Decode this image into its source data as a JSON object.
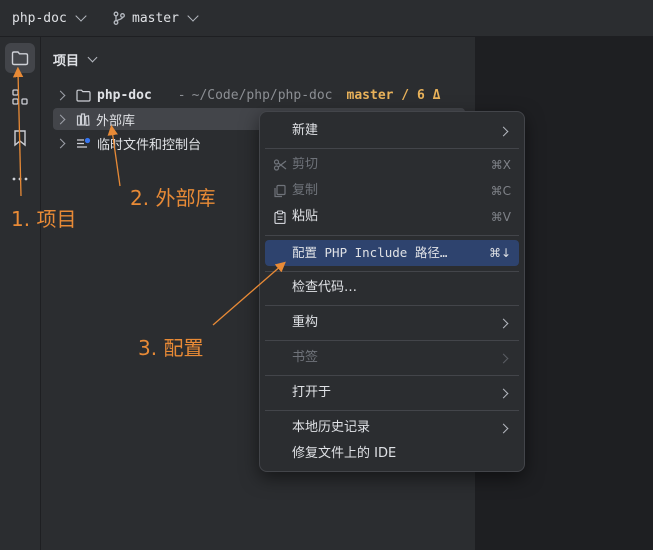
{
  "titlebar": {
    "project_name": "php-doc",
    "branch_name": "master"
  },
  "panel": {
    "title": "项目"
  },
  "tree": {
    "root": {
      "name": "php-doc",
      "path": "~/Code/php/php-doc",
      "branch_info": "master / 6 Δ"
    },
    "external_libs": "外部库",
    "scratches": "临时文件和控制台"
  },
  "context_menu": {
    "new": "新建",
    "cut": "剪切",
    "cut_shortcut": "⌘X",
    "copy": "复制",
    "copy_shortcut": "⌘C",
    "paste": "粘贴",
    "paste_shortcut": "⌘V",
    "configure_include": "配置 PHP Include 路径…",
    "configure_include_shortcut": "⌘↓",
    "inspect_code": "检查代码…",
    "refactor": "重构",
    "bookmarks": "书签",
    "open_in": "打开于",
    "local_history": "本地历史记录",
    "repair_ide": "修复文件上的 IDE"
  },
  "annotations": {
    "step1": "1. 项目",
    "step2": "2. 外部库",
    "step3": "3. 配置"
  },
  "colors": {
    "annotation": "#e88a36",
    "menu_highlight": "#2e436e",
    "branch_highlight": "#e9b25a"
  }
}
